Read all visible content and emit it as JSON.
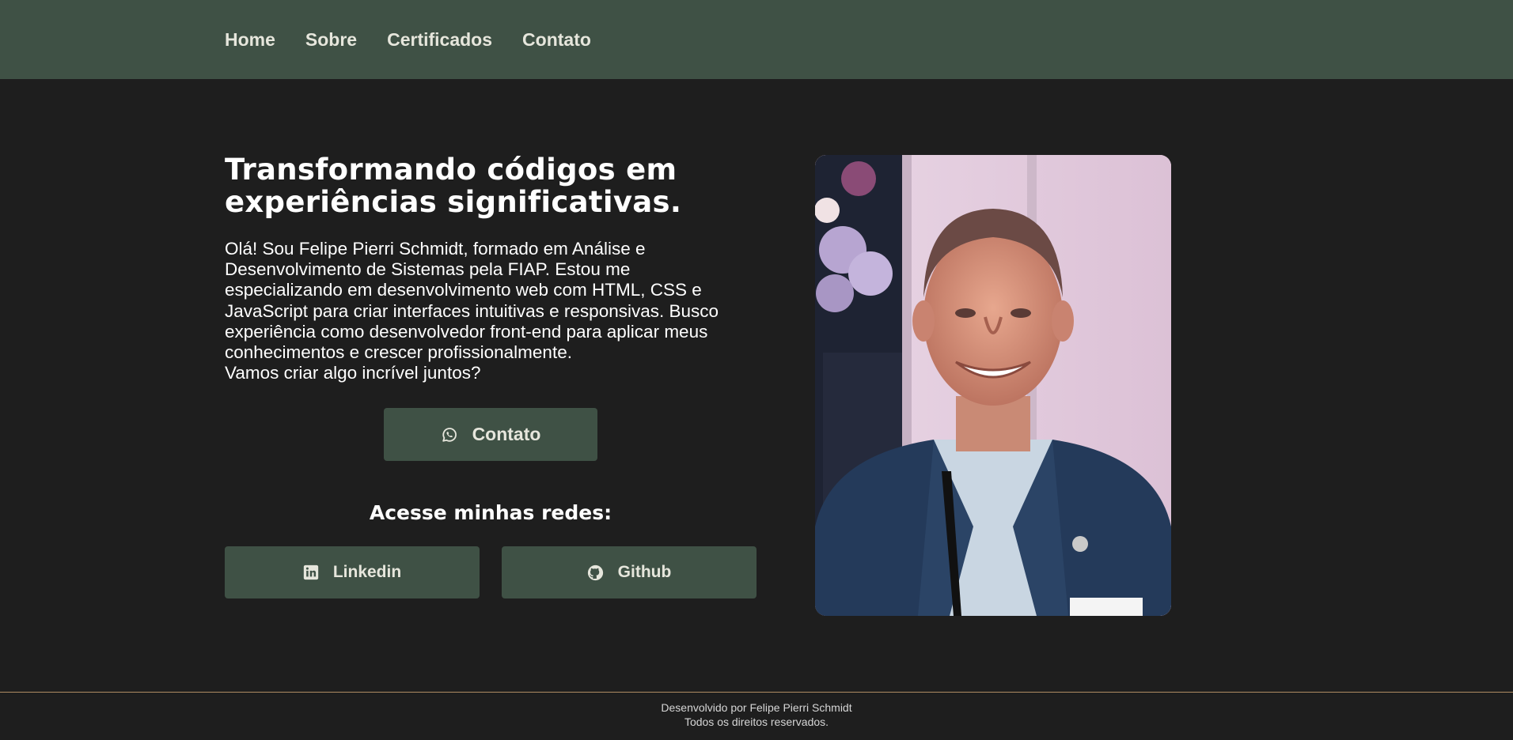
{
  "nav": {
    "items": [
      {
        "label": "Home"
      },
      {
        "label": "Sobre"
      },
      {
        "label": "Certificados"
      },
      {
        "label": "Contato"
      }
    ]
  },
  "hero": {
    "headline_line1": "Transformando códigos em",
    "headline_line2": "experiências significativas.",
    "intro_lines": [
      "Olá! Sou Felipe Pierri Schmidt, formado em Análise e",
      "Desenvolvimento de Sistemas pela FIAP. Estou me",
      "especializando em desenvolvimento web com HTML, CSS e",
      "JavaScript para criar interfaces intuitivas e responsivas. Busco",
      "experiência como desenvolvedor front-end para aplicar meus",
      "conhecimentos e crescer profissionalmente.",
      "Vamos criar algo incrível juntos?"
    ],
    "contact_button": {
      "label": "Contato",
      "icon": "whatsapp-icon"
    },
    "networks_title": "Acesse minhas redes:",
    "linkedin_button": {
      "label": "Linkedin",
      "icon": "linkedin-icon"
    },
    "github_button": {
      "label": "Github",
      "icon": "github-icon"
    }
  },
  "footer": {
    "line1": "Desenvolvido por Felipe Pierri Schmidt",
    "line2": "Todos os direitos reservados."
  },
  "colors": {
    "background": "#1e1e1e",
    "header": "#3f5145",
    "button": "#3f5145",
    "button_text": "#e6e6dc",
    "footer_border": "#b08b63"
  }
}
